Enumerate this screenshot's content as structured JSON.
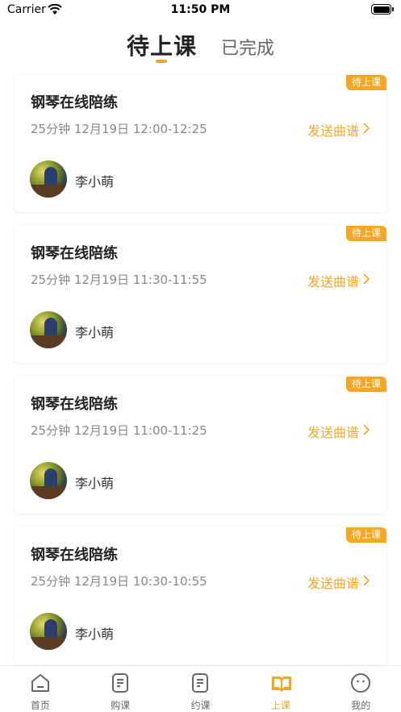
{
  "status_bar": {
    "carrier": "Carrier",
    "time": "11:50 PM"
  },
  "header": {
    "tabs": [
      {
        "label": "待上课",
        "active": true
      },
      {
        "label": "已完成",
        "active": false
      }
    ]
  },
  "lessons": [
    {
      "badge": "待上课",
      "title": "钢琴在线陪练",
      "meta": "25分钟 12月19日 12:00-12:25",
      "action": "发送曲谱",
      "student": "李小萌"
    },
    {
      "badge": "待上课",
      "title": "钢琴在线陪练",
      "meta": "25分钟 12月19日 11:30-11:55",
      "action": "发送曲谱",
      "student": "李小萌"
    },
    {
      "badge": "待上课",
      "title": "钢琴在线陪练",
      "meta": "25分钟 12月19日 11:00-11:25",
      "action": "发送曲谱",
      "student": "李小萌"
    },
    {
      "badge": "待上课",
      "title": "钢琴在线陪练",
      "meta": "25分钟 12月19日 10:30-10:55",
      "action": "发送曲谱",
      "student": "李小萌"
    }
  ],
  "tabbar": {
    "items": [
      {
        "label": "首页",
        "icon": "home-icon",
        "active": false
      },
      {
        "label": "购课",
        "icon": "document-icon",
        "active": false
      },
      {
        "label": "约课",
        "icon": "document-icon",
        "active": false
      },
      {
        "label": "上课",
        "icon": "open-book-icon",
        "active": true
      },
      {
        "label": "我的",
        "icon": "smile-icon",
        "active": false
      }
    ]
  },
  "colors": {
    "accent": "#f5a623",
    "text": "#222222",
    "muted": "#888888"
  }
}
